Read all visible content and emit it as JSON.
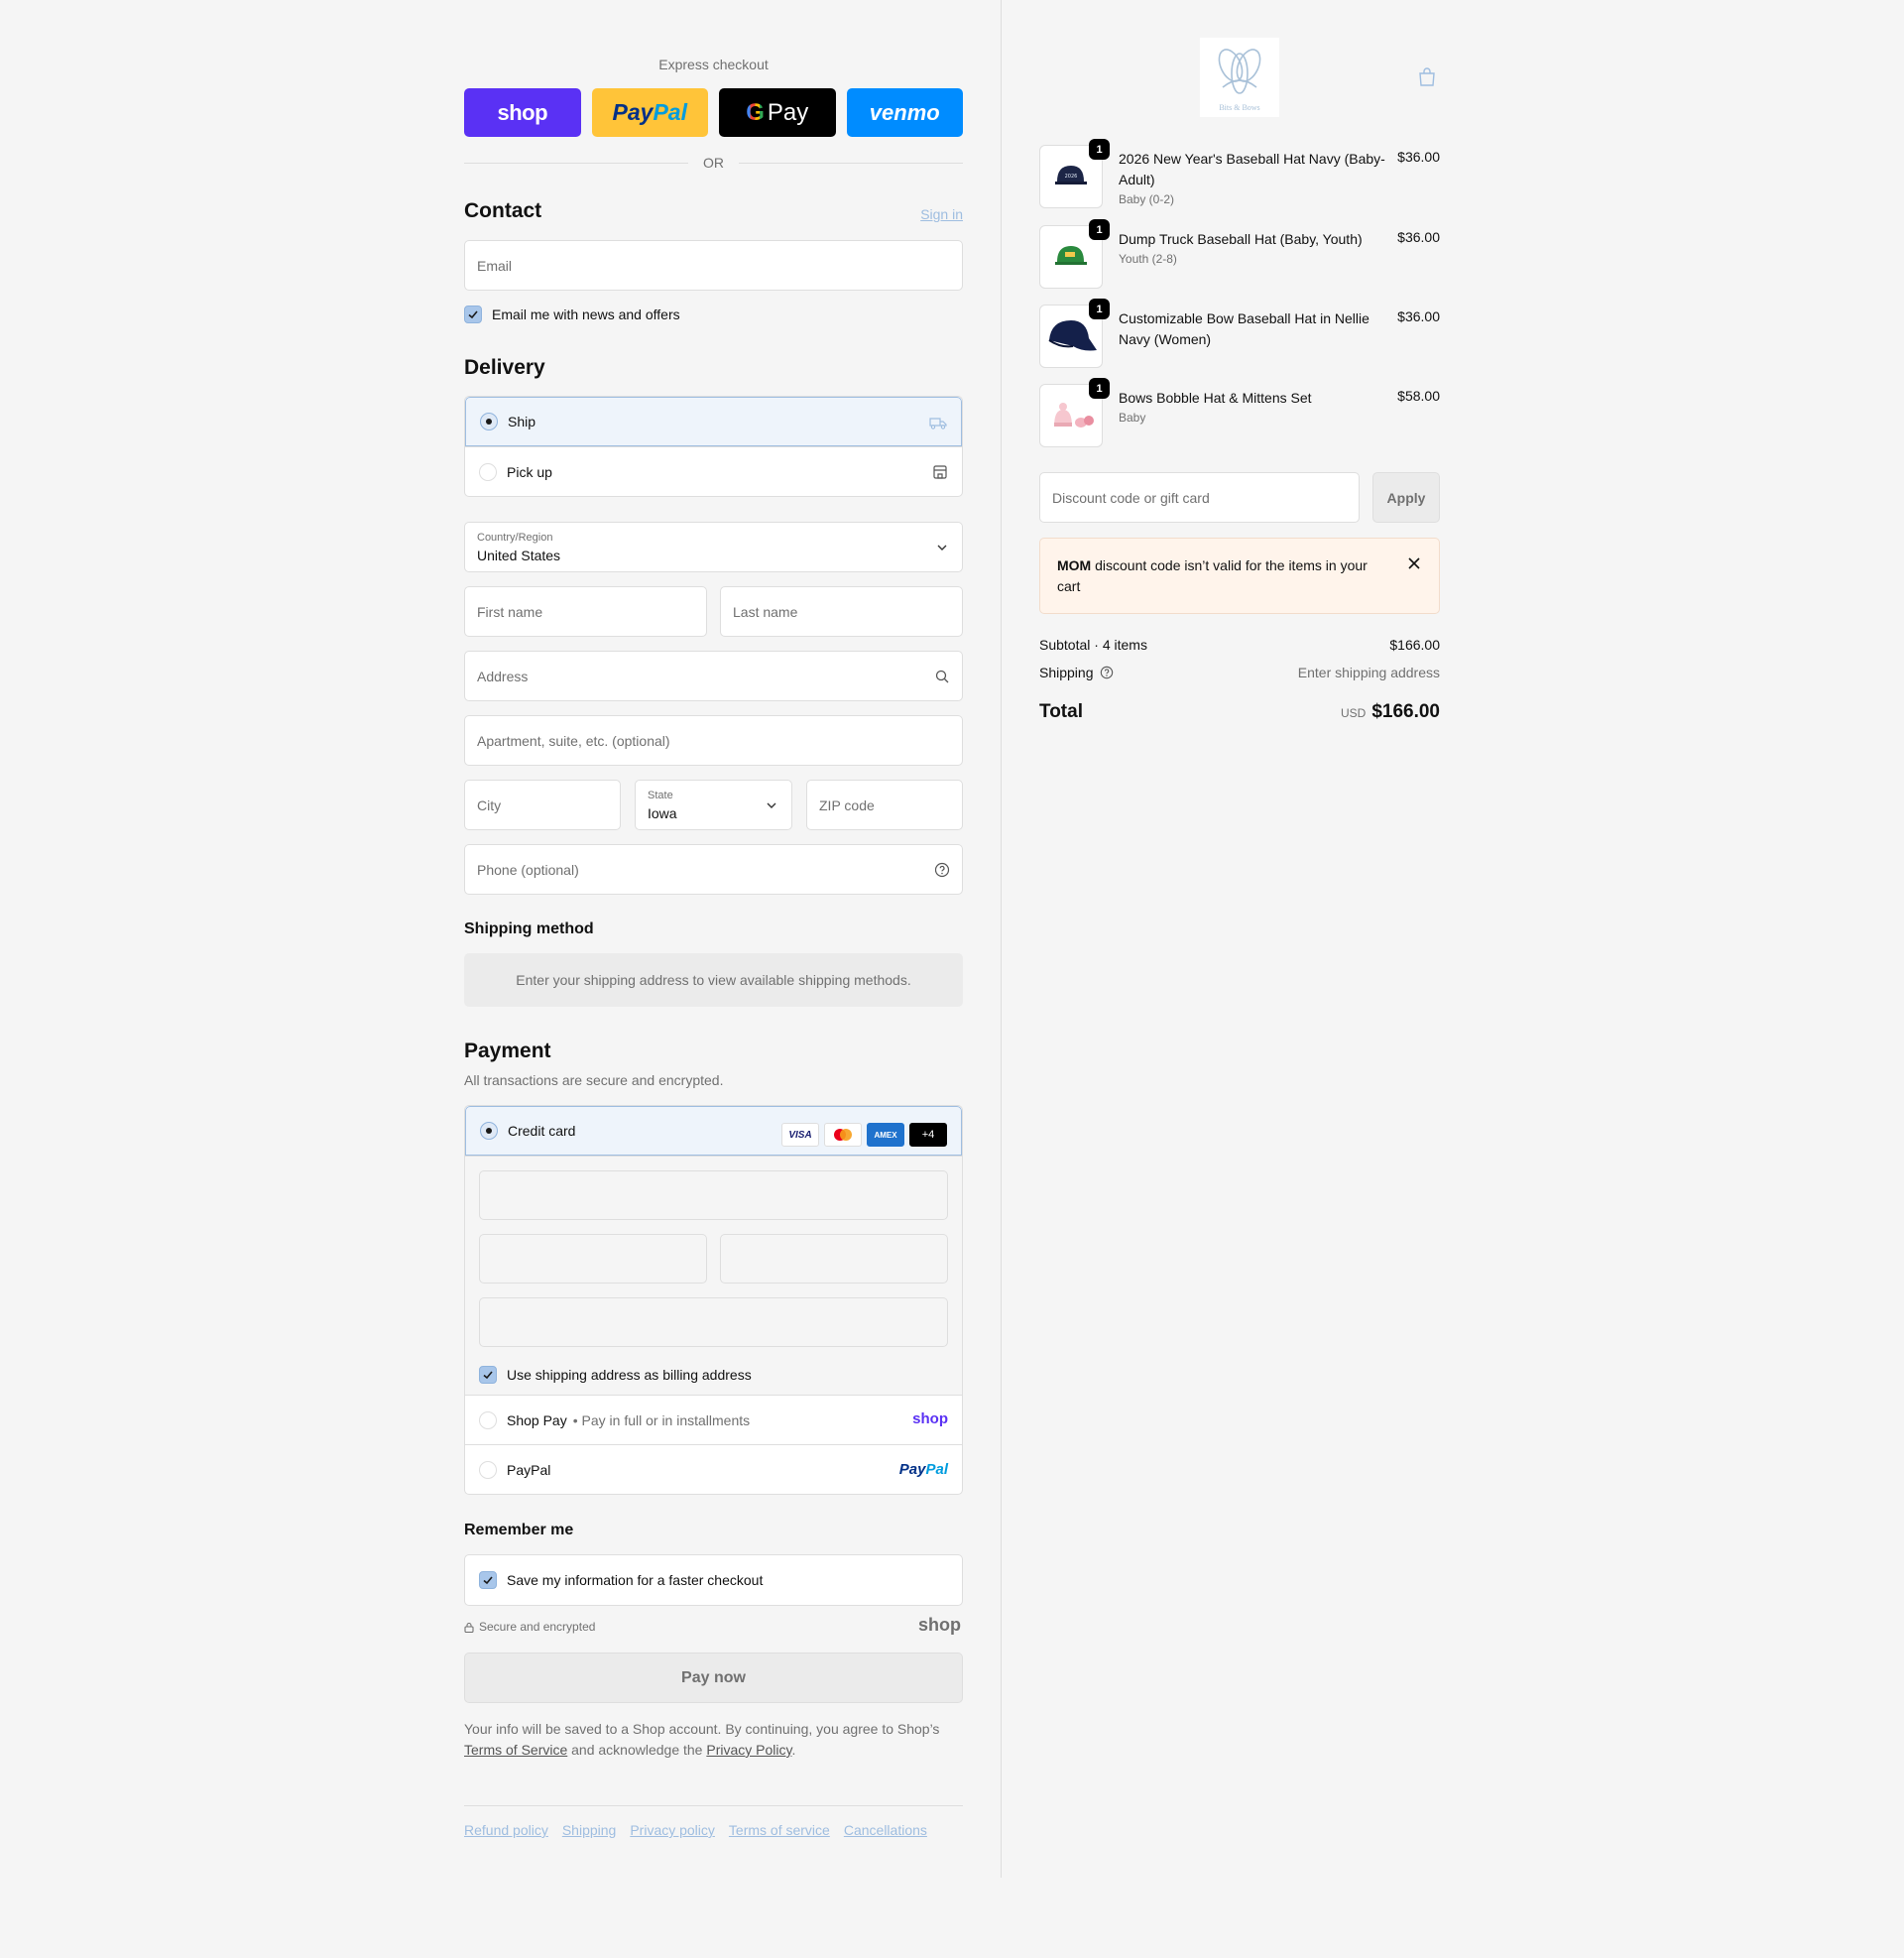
{
  "express": {
    "title": "Express checkout",
    "buttons": {
      "shop": "shop",
      "paypal_1": "Pay",
      "paypal_2": "Pal",
      "gpay_g": "G",
      "gpay": "Pay",
      "venmo": "venmo"
    },
    "or": "OR"
  },
  "contact": {
    "title": "Contact",
    "signin": "Sign in",
    "email_placeholder": "Email",
    "news_label": "Email me with news and offers"
  },
  "delivery": {
    "title": "Delivery",
    "options": [
      {
        "label": "Ship",
        "selected": true
      },
      {
        "label": "Pick up",
        "selected": false
      }
    ],
    "country_label": "Country/Region",
    "country_value": "United States",
    "first_name": "First name",
    "last_name": "Last name",
    "address": "Address",
    "apartment": "Apartment, suite, etc. (optional)",
    "city": "City",
    "state_label": "State",
    "state_value": "Iowa",
    "zip": "ZIP code",
    "phone": "Phone (optional)"
  },
  "shipping_method": {
    "title": "Shipping method",
    "message": "Enter your shipping address to view available shipping methods."
  },
  "payment": {
    "title": "Payment",
    "subtitle": "All transactions are secure and encrypted.",
    "credit_card": "Credit card",
    "cards": {
      "visa": "VISA",
      "amex": "AMEX",
      "more": "+4"
    },
    "billing_label": "Use shipping address as billing address",
    "shop_pay": "Shop Pay",
    "shop_pay_sub": "Pay in full or in installments",
    "shop_pay_logo": "shop",
    "paypal": "PayPal",
    "paypal_logo_1": "Pay",
    "paypal_logo_2": "Pal"
  },
  "remember": {
    "title": "Remember me",
    "save_label": "Save my information for a faster checkout",
    "secure": "Secure and encrypted",
    "brand": "shop"
  },
  "pay_now": "Pay now",
  "legal": {
    "text1": "Your info will be saved to a Shop account. By continuing, you agree to Shop’s ",
    "terms": "Terms of Service",
    "text2": " and acknowledge the ",
    "privacy": "Privacy Policy",
    "text3": "."
  },
  "footer": [
    "Refund policy",
    "Shipping",
    "Privacy policy",
    "Terms of service",
    "Cancellations"
  ],
  "store": {
    "logo_text": "Bits & Bows"
  },
  "items": [
    {
      "name": "2026 New Year's Baseball Hat Navy (Baby-Adult)",
      "variant": "Baby (0-2)",
      "price": "$36.00",
      "qty": "1"
    },
    {
      "name": "Dump Truck Baseball Hat (Baby, Youth)",
      "variant": "Youth (2-8)",
      "price": "$36.00",
      "qty": "1"
    },
    {
      "name": "Customizable Bow Baseball Hat in Nellie Navy (Women)",
      "variant": "",
      "price": "$36.00",
      "qty": "1"
    },
    {
      "name": "Bows Bobble Hat & Mittens Set",
      "variant": "Baby",
      "price": "$58.00",
      "qty": "1"
    }
  ],
  "discount": {
    "placeholder": "Discount code or gift card",
    "apply": "Apply",
    "notice_code": "MOM",
    "notice_text": " discount code isn’t valid for the items in your cart"
  },
  "summary": {
    "subtotal_label": "Subtotal · 4 items",
    "subtotal_value": "$166.00",
    "shipping_label": "Shipping",
    "shipping_value": "Enter shipping address",
    "total_label": "Total",
    "currency": "USD",
    "total_value": "$166.00"
  },
  "colors": {
    "shop_purple": "#5a31f4",
    "paypal_yellow": "#ffc439",
    "venmo_blue": "#008cff",
    "link_blue": "#9ebde0",
    "notice_bg": "#fff4eb"
  }
}
